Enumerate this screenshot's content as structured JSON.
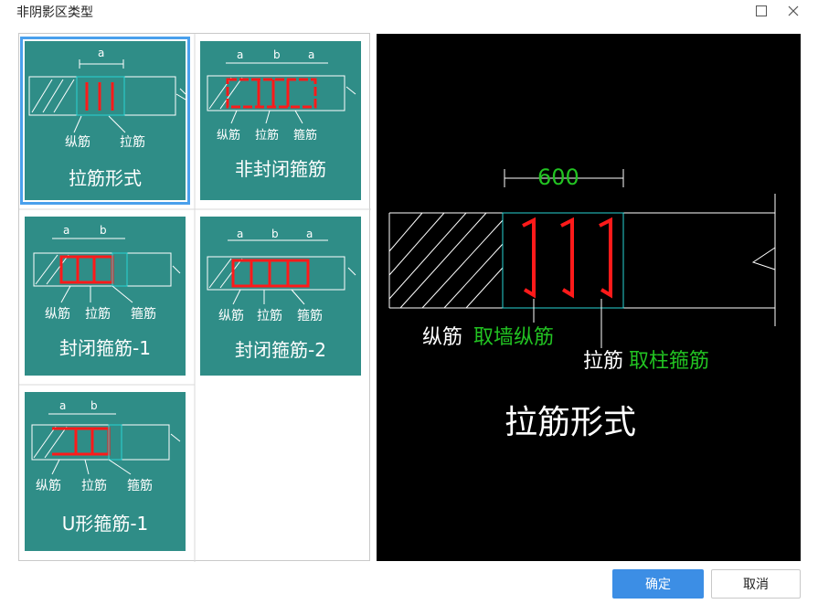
{
  "window": {
    "title": "非阴影区类型"
  },
  "options": [
    {
      "title": "拉筋形式",
      "labels": [
        "纵筋",
        "拉筋"
      ],
      "dims": [
        "a"
      ]
    },
    {
      "title": "非封闭箍筋",
      "labels": [
        "纵筋",
        "拉筋",
        "箍筋"
      ],
      "dims": [
        "a",
        "b",
        "a"
      ]
    },
    {
      "title": "封闭箍筋-1",
      "labels": [
        "纵筋",
        "拉筋",
        "箍筋"
      ],
      "dims": [
        "a",
        "b"
      ]
    },
    {
      "title": "封闭箍筋-2",
      "labels": [
        "纵筋",
        "拉筋",
        "箍筋"
      ],
      "dims": [
        "a",
        "b",
        "a"
      ]
    },
    {
      "title": "U形箍筋-1",
      "labels": [
        "纵筋",
        "拉筋",
        "箍筋"
      ],
      "dims": [
        "a",
        "b"
      ]
    }
  ],
  "preview": {
    "dimension": "600",
    "longitudinal_label": "纵筋",
    "longitudinal_note": "取墙纵筋",
    "tie_label": "拉筋",
    "tie_note": "取柱箍筋",
    "title": "拉筋形式"
  },
  "buttons": {
    "ok": "确定",
    "cancel": "取消"
  },
  "colors": {
    "card": "#2f8d87",
    "selection": "#4aa0ec",
    "rebar": "#ff1a1a",
    "accent_text": "#22c322",
    "primary_button": "#3c8ee5"
  }
}
